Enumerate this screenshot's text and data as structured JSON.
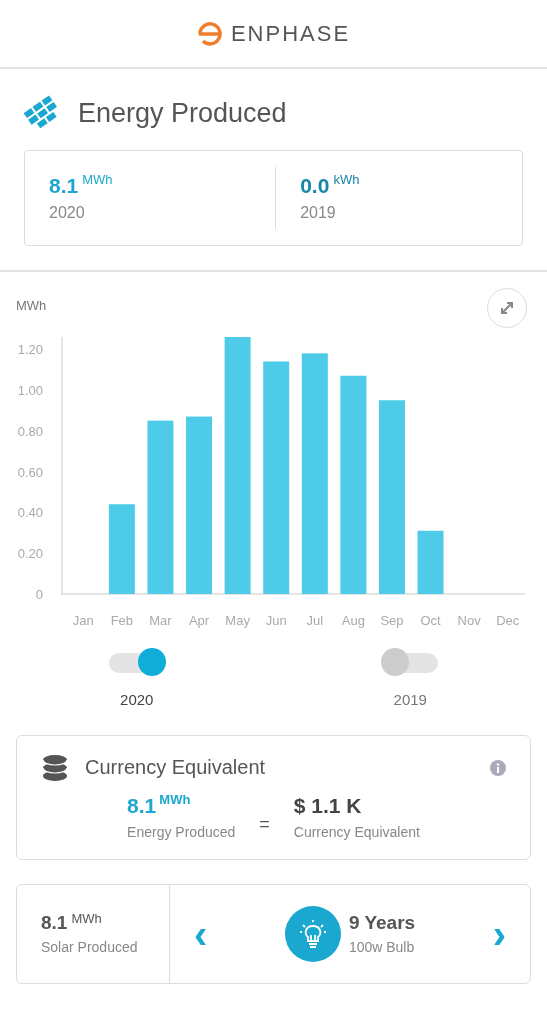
{
  "header": {
    "brand": "ENPHASE"
  },
  "title": "Energy Produced",
  "summary": [
    {
      "value": "8.1",
      "unit": "MWh",
      "label": "2020"
    },
    {
      "value": "0.0",
      "unit": "kWh",
      "label": "2019"
    }
  ],
  "chart": {
    "unit": "MWh",
    "chart_data": {
      "type": "bar",
      "categories": [
        "Jan",
        "Feb",
        "Mar",
        "Apr",
        "May",
        "Jun",
        "Jul",
        "Aug",
        "Sep",
        "Oct",
        "Nov",
        "Dec"
      ],
      "series": [
        {
          "color": "#4ecbe8",
          "values": [
            0,
            0.44,
            0.85,
            0.87,
            1.26,
            1.14,
            1.18,
            1.07,
            0.95,
            0.31,
            0,
            0
          ]
        }
      ],
      "ylim": [
        0,
        1.26
      ],
      "yticks": [
        {
          "value": 0,
          "label": "0"
        },
        {
          "value": 0.2,
          "label": "0.20"
        },
        {
          "value": 0.4,
          "label": "0.40"
        },
        {
          "value": 0.6,
          "label": "0.60"
        },
        {
          "value": 0.8,
          "label": "0.80"
        },
        {
          "value": 1.0,
          "label": "1.00"
        },
        {
          "value": 1.2,
          "label": "1.20"
        }
      ]
    }
  },
  "toggles": [
    {
      "label": "2020",
      "on": true
    },
    {
      "label": "2019",
      "on": false
    }
  ],
  "currency": {
    "title": "Currency Equivalent",
    "energy_value": "8.1",
    "energy_unit": "MWh",
    "energy_label": "Energy Produced",
    "equals": "=",
    "amount": "$ 1.1 K",
    "amount_label": "Currency Equivalent"
  },
  "equivalent": {
    "value": "8.1",
    "unit": "MWh",
    "label": "Solar Produced",
    "prev": "‹",
    "next": "›",
    "item_value": "9 Years",
    "item_label": "100w Bulb"
  }
}
